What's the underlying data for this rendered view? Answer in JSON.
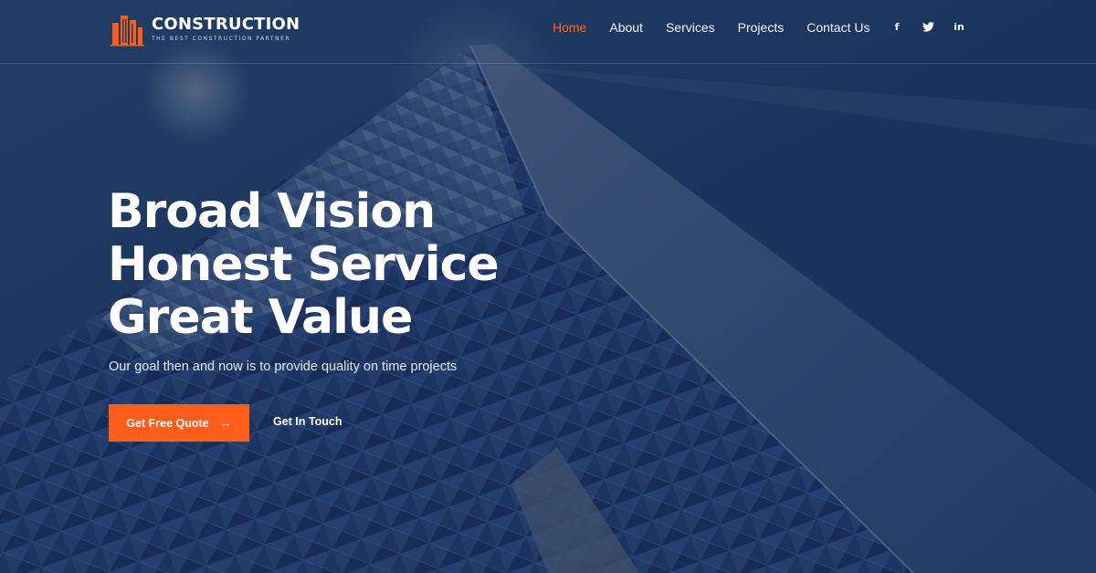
{
  "brand": {
    "name": "CONSTRUCTION",
    "tagline": "THE BEST CONSTRUCTION PARTNER",
    "logo_icon": "building-logo-icon",
    "accent_color": "#ff5e1a"
  },
  "nav": {
    "items": [
      {
        "label": "Home",
        "active": true
      },
      {
        "label": "About",
        "active": false
      },
      {
        "label": "Services",
        "active": false
      },
      {
        "label": "Projects",
        "active": false
      },
      {
        "label": "Contact Us",
        "active": false
      }
    ]
  },
  "social": {
    "facebook": "f",
    "twitter": "twitter-icon",
    "linkedin": "in"
  },
  "hero": {
    "title_line1": "Broad Vision",
    "title_line2": "Honest Service",
    "title_line3": "Great Value",
    "subtitle": "Our goal then and now is to provide quality on time projects",
    "primary_button": "Get Free Quote",
    "primary_button_icon": "arrow-right-icon",
    "secondary_button": "Get In Touch"
  }
}
